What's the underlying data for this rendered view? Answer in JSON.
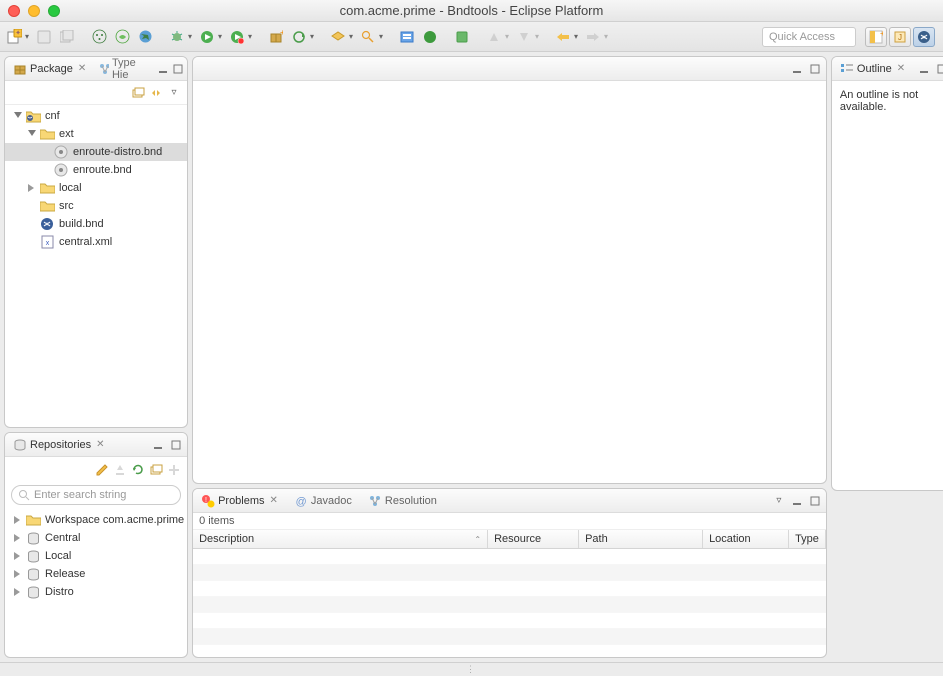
{
  "window": {
    "title": "com.acme.prime - Bndtools - Eclipse Platform"
  },
  "toolbar": {
    "quick_access_placeholder": "Quick Access"
  },
  "views": {
    "package": {
      "title": "Package",
      "second_tab": "Type Hie"
    },
    "repositories": {
      "title": "Repositories",
      "search_placeholder": "Enter search string",
      "items": [
        "Workspace com.acme.prime",
        "Central",
        "Local",
        "Release",
        "Distro"
      ]
    },
    "outline": {
      "title": "Outline",
      "empty": "An outline is not available."
    },
    "problems": {
      "tabs": [
        "Problems",
        "Javadoc",
        "Resolution"
      ],
      "items_count": "0 items",
      "columns": [
        "Description",
        "Resource",
        "Path",
        "Location",
        "Type"
      ]
    }
  },
  "tree": {
    "root": "cnf",
    "ext": "ext",
    "ext_children": [
      "enroute-distro.bnd",
      "enroute.bnd"
    ],
    "local": "local",
    "src": "src",
    "build": "build.bnd",
    "central": "central.xml"
  }
}
